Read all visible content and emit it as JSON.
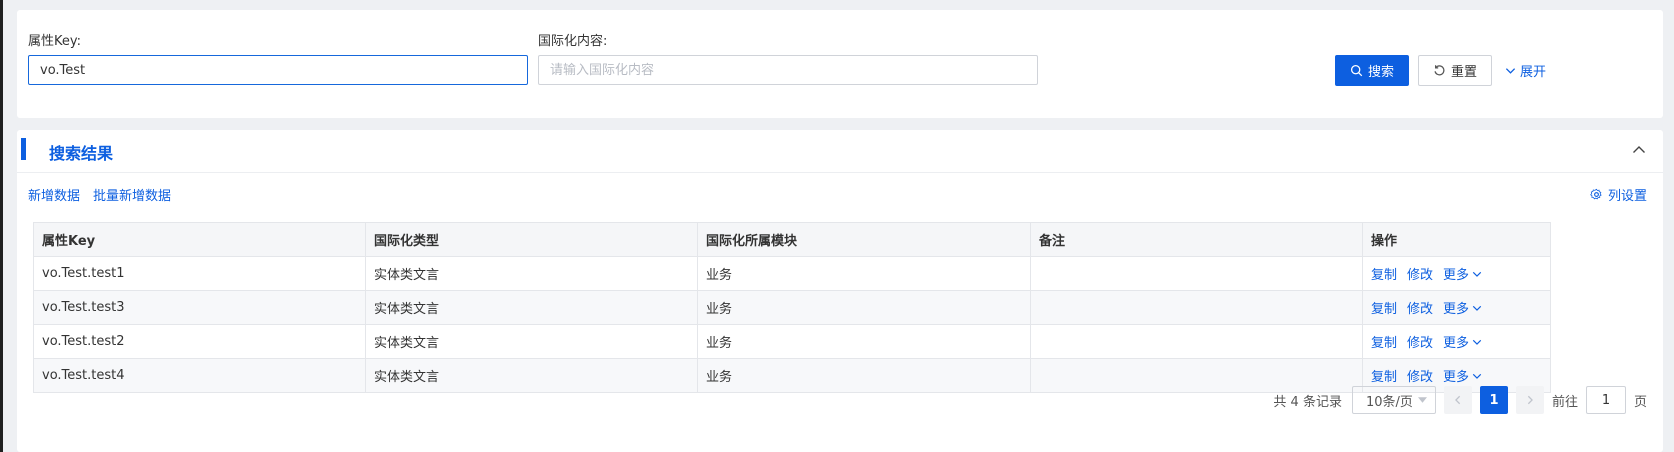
{
  "search": {
    "key_label": "属性Key:",
    "key_value": "vo.Test",
    "content_label": "国际化内容:",
    "content_placeholder": "请输入国际化内容",
    "search_button": "搜索",
    "reset_button": "重置",
    "expand_button": "展开"
  },
  "results": {
    "title": "搜索结果",
    "add_link": "新增数据",
    "batch_add_link": "批量新增数据",
    "column_settings": "列设置",
    "columns": [
      "属性Key",
      "国际化类型",
      "国际化所属模块",
      "备注",
      "操作"
    ],
    "rows": [
      {
        "key": "vo.Test.test1",
        "type": "实体类文言",
        "module": "业务",
        "remark": ""
      },
      {
        "key": "vo.Test.test3",
        "type": "实体类文言",
        "module": "业务",
        "remark": ""
      },
      {
        "key": "vo.Test.test2",
        "type": "实体类文言",
        "module": "业务",
        "remark": ""
      },
      {
        "key": "vo.Test.test4",
        "type": "实体类文言",
        "module": "业务",
        "remark": ""
      }
    ],
    "actions": {
      "copy": "复制",
      "edit": "修改",
      "more": "更多"
    }
  },
  "pagination": {
    "total_text": "共 4 条记录",
    "page_size": "10条/页",
    "current_page": "1",
    "goto_label": "前往",
    "goto_value": "1",
    "page_suffix": "页"
  },
  "colors": {
    "primary": "#0d5fe0",
    "border": "#d0d3d9"
  }
}
